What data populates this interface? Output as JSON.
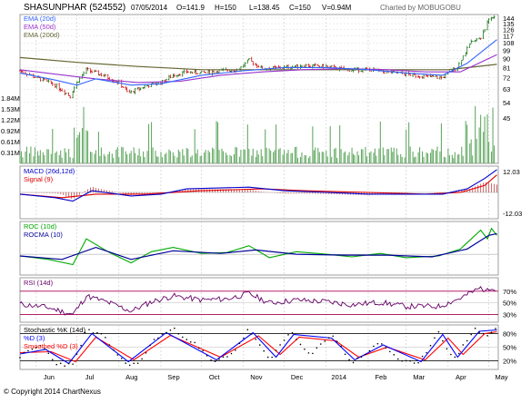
{
  "header": {
    "symbol": "SHASUNPHAR (524552)",
    "date": "07/05/2014",
    "open": "O=141.9",
    "high": "H=150",
    "low": "L=138.45",
    "close": "C=150",
    "volume": "V=0.94M",
    "credit": "Charted by MOBUGOBU"
  },
  "footer": {
    "copyright": "© Copyright 2014 ChartNexus"
  },
  "colors": {
    "price_up": "#006600",
    "price_down": "#cc0000",
    "ema20": "#3366ff",
    "ema50": "#9933cc",
    "ema200": "#666633",
    "volume": "#66aa66",
    "macd": "#0000cc",
    "signal": "#dd0000",
    "roc": "#00aa00",
    "rocma": "#000099",
    "rsi": "#660066",
    "stoch_k": "#000000",
    "stoch_d": "#0000ff",
    "stoch_smooth": "#ff0000",
    "level_line": "#aa0055"
  },
  "chart_data": [
    {
      "type": "candlestick",
      "panel": "price",
      "legend": [
        "EMA (20d)",
        "EMA (50d)",
        "EMA (200d)"
      ],
      "y_ticks": [
        45,
        54,
        63,
        72,
        81,
        90,
        99,
        108,
        117,
        126,
        135,
        144
      ],
      "ylim": [
        45,
        147
      ],
      "volume_ticks": [
        "0.31M",
        "0.61M",
        "0.92M",
        "1.22M",
        "1.53M",
        "1.84M"
      ],
      "x_ticks": [
        "Jun",
        "Jul",
        "Aug",
        "Sep",
        "Oct",
        "Nov",
        "Dec",
        "2014",
        "Feb",
        "Mar",
        "Apr",
        "May"
      ],
      "close_path": [
        [
          "2013-05-20",
          78
        ],
        [
          "2013-06-01",
          72
        ],
        [
          "2013-06-15",
          66
        ],
        [
          "2013-06-26",
          58
        ],
        [
          "2013-07-01",
          68
        ],
        [
          "2013-07-08",
          79
        ],
        [
          "2013-07-20",
          74
        ],
        [
          "2013-08-01",
          68
        ],
        [
          "2013-08-08",
          60
        ],
        [
          "2013-08-20",
          65
        ],
        [
          "2013-09-01",
          68
        ],
        [
          "2013-09-10",
          74
        ],
        [
          "2013-09-20",
          77
        ],
        [
          "2013-10-01",
          76
        ],
        [
          "2013-10-15",
          78
        ],
        [
          "2013-10-28",
          79
        ],
        [
          "2013-11-05",
          88
        ],
        [
          "2013-11-15",
          80
        ],
        [
          "2013-12-01",
          81
        ],
        [
          "2013-12-15",
          83
        ],
        [
          "2014-01-01",
          82
        ],
        [
          "2014-01-15",
          79
        ],
        [
          "2014-02-01",
          79
        ],
        [
          "2014-02-15",
          77
        ],
        [
          "2014-03-01",
          75
        ],
        [
          "2014-03-15",
          73
        ],
        [
          "2014-03-28",
          72
        ],
        [
          "2014-04-08",
          82
        ],
        [
          "2014-04-18",
          108
        ],
        [
          "2014-04-25",
          115
        ],
        [
          "2014-05-01",
          140
        ],
        [
          "2014-05-07",
          150
        ]
      ],
      "ema20": [
        [
          "2013-05-20",
          76
        ],
        [
          "2013-06-15",
          70
        ],
        [
          "2013-07-01",
          66
        ],
        [
          "2013-07-15",
          71
        ],
        [
          "2013-08-10",
          66
        ],
        [
          "2013-09-01",
          67
        ],
        [
          "2013-10-01",
          74
        ],
        [
          "2013-11-01",
          78
        ],
        [
          "2013-12-01",
          81
        ],
        [
          "2014-01-01",
          81
        ],
        [
          "2014-02-01",
          79
        ],
        [
          "2014-03-01",
          76
        ],
        [
          "2014-03-28",
          74
        ],
        [
          "2014-04-15",
          85
        ],
        [
          "2014-05-07",
          112
        ]
      ],
      "ema50": [
        [
          "2013-05-20",
          79
        ],
        [
          "2013-06-15",
          75
        ],
        [
          "2013-07-15",
          71
        ],
        [
          "2013-08-15",
          68
        ],
        [
          "2013-09-15",
          69
        ],
        [
          "2013-10-15",
          74
        ],
        [
          "2013-11-15",
          77
        ],
        [
          "2013-12-15",
          79
        ],
        [
          "2014-01-15",
          80
        ],
        [
          "2014-02-15",
          79
        ],
        [
          "2014-03-15",
          77
        ],
        [
          "2014-04-10",
          77
        ],
        [
          "2014-05-07",
          94
        ]
      ],
      "ema200": [
        [
          "2013-05-20",
          91
        ],
        [
          "2013-07-01",
          86
        ],
        [
          "2013-08-15",
          82
        ],
        [
          "2013-10-01",
          79
        ],
        [
          "2013-11-15",
          79
        ],
        [
          "2014-01-01",
          79
        ],
        [
          "2014-02-15",
          79
        ],
        [
          "2014-04-01",
          79
        ],
        [
          "2014-05-07",
          84
        ]
      ]
    },
    {
      "type": "line",
      "panel": "macd",
      "legend": [
        "MACD (26d,12d)",
        "Signal (9)"
      ],
      "y_ticks": [
        "12.03",
        "-12.03"
      ],
      "ylim": [
        -14,
        14
      ],
      "macd": [
        [
          "2013-05-20",
          -1
        ],
        [
          "2013-06-15",
          -3
        ],
        [
          "2013-06-28",
          -5
        ],
        [
          "2013-07-12",
          1
        ],
        [
          "2013-08-10",
          -2
        ],
        [
          "2013-09-01",
          -1
        ],
        [
          "2013-09-20",
          2
        ],
        [
          "2013-11-05",
          3
        ],
        [
          "2013-12-01",
          1
        ],
        [
          "2014-01-01",
          0
        ],
        [
          "2014-02-01",
          -1
        ],
        [
          "2014-03-01",
          -1
        ],
        [
          "2014-03-28",
          -1
        ],
        [
          "2014-04-15",
          2
        ],
        [
          "2014-04-28",
          8
        ],
        [
          "2014-05-07",
          13
        ]
      ],
      "signal": [
        [
          "2013-05-20",
          -1
        ],
        [
          "2013-06-20",
          -3
        ],
        [
          "2013-07-15",
          -1
        ],
        [
          "2013-08-20",
          -1
        ],
        [
          "2013-10-01",
          1
        ],
        [
          "2013-11-15",
          2
        ],
        [
          "2013-12-15",
          1
        ],
        [
          "2014-02-01",
          0
        ],
        [
          "2014-03-15",
          -1
        ],
        [
          "2014-04-10",
          0
        ],
        [
          "2014-04-28",
          4
        ],
        [
          "2014-05-07",
          10
        ]
      ]
    },
    {
      "type": "line",
      "panel": "roc",
      "legend": [
        "ROC (10d)",
        "ROCMA (10)"
      ],
      "roc": [
        [
          "2013-05-20",
          -2
        ],
        [
          "2013-06-10",
          -6
        ],
        [
          "2013-06-28",
          -12
        ],
        [
          "2013-07-08",
          18
        ],
        [
          "2013-07-25",
          2
        ],
        [
          "2013-08-10",
          -10
        ],
        [
          "2013-08-25",
          3
        ],
        [
          "2013-09-10",
          8
        ],
        [
          "2013-10-01",
          1
        ],
        [
          "2013-10-20",
          2
        ],
        [
          "2013-11-05",
          10
        ],
        [
          "2013-11-20",
          -4
        ],
        [
          "2013-12-10",
          3
        ],
        [
          "2014-01-01",
          0
        ],
        [
          "2014-01-20",
          -3
        ],
        [
          "2014-02-10",
          1
        ],
        [
          "2014-03-01",
          -4
        ],
        [
          "2014-03-25",
          -2
        ],
        [
          "2014-04-10",
          6
        ],
        [
          "2014-04-25",
          28
        ],
        [
          "2014-04-30",
          18
        ],
        [
          "2014-05-03",
          30
        ],
        [
          "2014-05-07",
          22
        ]
      ],
      "rocma": [
        [
          "2013-05-20",
          -2
        ],
        [
          "2013-06-20",
          -6
        ],
        [
          "2013-07-15",
          8
        ],
        [
          "2013-08-10",
          -6
        ],
        [
          "2013-09-10",
          4
        ],
        [
          "2013-10-15",
          1
        ],
        [
          "2013-11-10",
          5
        ],
        [
          "2013-12-10",
          0
        ],
        [
          "2014-01-15",
          -1
        ],
        [
          "2014-02-15",
          -1
        ],
        [
          "2014-03-20",
          -3
        ],
        [
          "2014-04-15",
          6
        ],
        [
          "2014-05-01",
          22
        ],
        [
          "2014-05-07",
          24
        ]
      ],
      "ylim": [
        -22,
        36
      ]
    },
    {
      "type": "line",
      "panel": "rsi",
      "legend": [
        "RSI (14d)"
      ],
      "y_ticks": [
        "70%",
        "50%",
        "30%"
      ],
      "ylim": [
        20,
        90
      ],
      "levels": [
        70,
        50,
        30
      ],
      "rsi": [
        [
          "2013-05-20",
          48
        ],
        [
          "2013-06-10",
          42
        ],
        [
          "2013-06-28",
          30
        ],
        [
          "2013-07-08",
          62
        ],
        [
          "2013-07-25",
          50
        ],
        [
          "2013-08-10",
          36
        ],
        [
          "2013-08-25",
          52
        ],
        [
          "2013-09-10",
          62
        ],
        [
          "2013-10-01",
          55
        ],
        [
          "2013-10-20",
          57
        ],
        [
          "2013-11-05",
          66
        ],
        [
          "2013-11-20",
          50
        ],
        [
          "2013-12-10",
          55
        ],
        [
          "2014-01-01",
          52
        ],
        [
          "2014-01-20",
          47
        ],
        [
          "2014-02-10",
          51
        ],
        [
          "2014-03-01",
          44
        ],
        [
          "2014-03-25",
          44
        ],
        [
          "2014-04-10",
          58
        ],
        [
          "2014-04-25",
          76
        ],
        [
          "2014-04-30",
          70
        ],
        [
          "2014-05-03",
          78
        ],
        [
          "2014-05-07",
          74
        ]
      ]
    },
    {
      "type": "line",
      "panel": "stochastic",
      "legend": [
        "Stochastic %K (14d)",
        "%D (3)",
        "Smoothed %D (3)"
      ],
      "y_ticks": [
        "80%",
        "50%",
        "20%"
      ],
      "ylim": [
        5,
        95
      ],
      "levels": [
        80,
        50,
        20
      ],
      "k": [
        [
          "2013-05-20",
          30
        ],
        [
          "2013-06-05",
          55
        ],
        [
          "2013-06-15",
          15
        ],
        [
          "2013-06-28",
          10
        ],
        [
          "2013-07-08",
          88
        ],
        [
          "2013-07-20",
          75
        ],
        [
          "2013-08-05",
          15
        ],
        [
          "2013-08-15",
          12
        ],
        [
          "2013-08-28",
          70
        ],
        [
          "2013-09-10",
          90
        ],
        [
          "2013-09-25",
          60
        ],
        [
          "2013-10-10",
          15
        ],
        [
          "2013-10-25",
          40
        ],
        [
          "2013-11-05",
          90
        ],
        [
          "2013-11-20",
          20
        ],
        [
          "2013-12-05",
          85
        ],
        [
          "2013-12-20",
          30
        ],
        [
          "2014-01-05",
          80
        ],
        [
          "2014-01-20",
          15
        ],
        [
          "2014-02-10",
          60
        ],
        [
          "2014-02-25",
          20
        ],
        [
          "2014-03-10",
          12
        ],
        [
          "2014-03-25",
          85
        ],
        [
          "2014-04-05",
          20
        ],
        [
          "2014-04-20",
          90
        ],
        [
          "2014-05-01",
          75
        ],
        [
          "2014-05-07",
          95
        ]
      ],
      "d": [
        [
          "2013-05-20",
          35
        ],
        [
          "2013-06-08",
          45
        ],
        [
          "2013-06-25",
          14
        ],
        [
          "2013-07-12",
          80
        ],
        [
          "2013-08-08",
          18
        ],
        [
          "2013-09-05",
          82
        ],
        [
          "2013-10-12",
          22
        ],
        [
          "2013-11-08",
          82
        ],
        [
          "2013-11-25",
          28
        ],
        [
          "2013-12-08",
          78
        ],
        [
          "2014-01-05",
          70
        ],
        [
          "2014-01-22",
          22
        ],
        [
          "2014-02-12",
          55
        ],
        [
          "2014-03-12",
          18
        ],
        [
          "2014-03-28",
          78
        ],
        [
          "2014-04-08",
          28
        ],
        [
          "2014-04-24",
          85
        ],
        [
          "2014-05-07",
          88
        ]
      ],
      "smoothed": [
        [
          "2013-05-20",
          38
        ],
        [
          "2013-06-12",
          40
        ],
        [
          "2013-06-30",
          18
        ],
        [
          "2013-07-15",
          72
        ],
        [
          "2013-08-12",
          22
        ],
        [
          "2013-09-08",
          76
        ],
        [
          "2013-10-15",
          28
        ],
        [
          "2013-11-12",
          75
        ],
        [
          "2013-11-28",
          34
        ],
        [
          "2013-12-12",
          72
        ],
        [
          "2014-01-08",
          64
        ],
        [
          "2014-01-25",
          28
        ],
        [
          "2014-02-15",
          50
        ],
        [
          "2014-03-15",
          22
        ],
        [
          "2014-04-01",
          70
        ],
        [
          "2014-04-12",
          34
        ],
        [
          "2014-04-28",
          80
        ],
        [
          "2014-05-07",
          84
        ]
      ]
    }
  ]
}
